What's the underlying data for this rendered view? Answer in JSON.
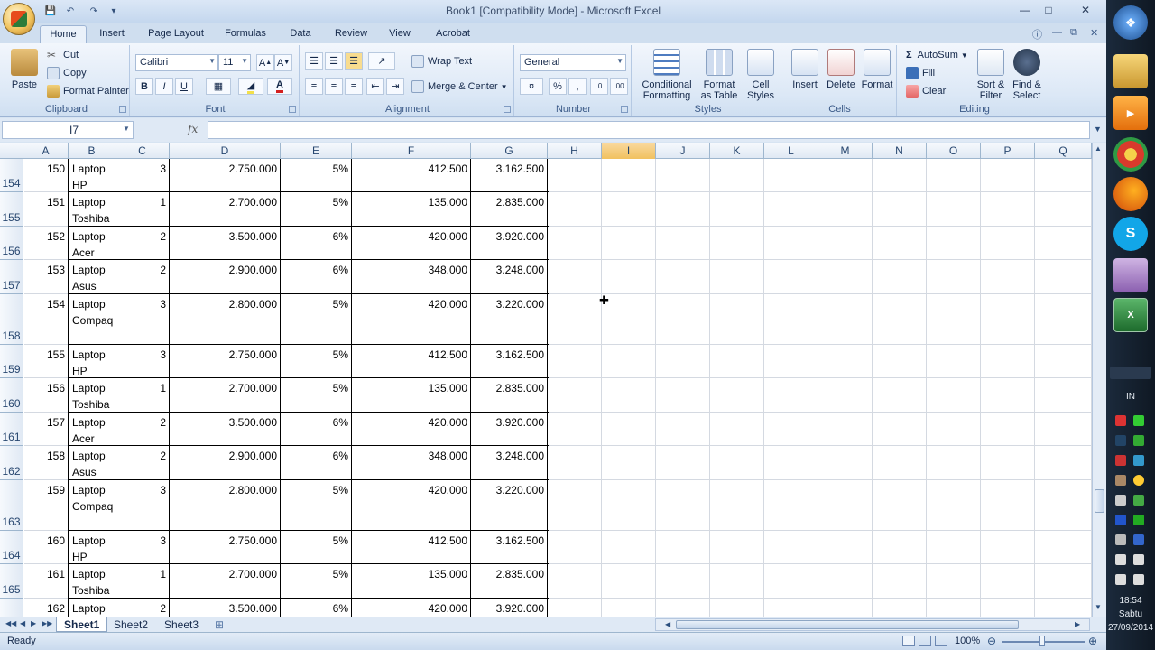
{
  "window": {
    "title": "Book1  [Compatibility Mode] - Microsoft Excel"
  },
  "ribbon_tabs": [
    "Home",
    "Insert",
    "Page Layout",
    "Formulas",
    "Data",
    "Review",
    "View",
    "Acrobat"
  ],
  "clipboard": {
    "paste": "Paste",
    "cut": "Cut",
    "copy": "Copy",
    "format_painter": "Format Painter",
    "label": "Clipboard"
  },
  "font": {
    "name": "Calibri",
    "size": "11",
    "bold": "B",
    "italic": "I",
    "underline": "U",
    "label": "Font"
  },
  "alignment": {
    "wrap_text": "Wrap Text",
    "merge_center": "Merge & Center",
    "label": "Alignment"
  },
  "number": {
    "format": "General",
    "percent": "%",
    "comma": ",",
    "label": "Number"
  },
  "styles": {
    "conditional_formatting": [
      "Conditional",
      "Formatting"
    ],
    "format_as_table": [
      "Format",
      "as Table"
    ],
    "cell_styles": [
      "Cell",
      "Styles"
    ],
    "label": "Styles"
  },
  "cells": {
    "insert": "Insert",
    "delete": "Delete",
    "format": "Format",
    "label": "Cells"
  },
  "editing": {
    "autosum": "AutoSum",
    "fill": "Fill",
    "clear": "Clear",
    "sort_filter": [
      "Sort &",
      "Filter"
    ],
    "find_select": [
      "Find &",
      "Select"
    ],
    "label": "Editing"
  },
  "formula_bar": {
    "name_box": "I7",
    "fx": "fx",
    "value": ""
  },
  "columns": [
    "A",
    "B",
    "C",
    "D",
    "E",
    "F",
    "G",
    "H",
    "I",
    "J",
    "K",
    "L",
    "M",
    "N",
    "O",
    "P",
    "Q"
  ],
  "selected_column": "I",
  "rows": [
    {
      "row": "154",
      "a": "150",
      "b1": "Laptop",
      "b2": "HP",
      "c": "3",
      "d": "2.750.000",
      "e": "5%",
      "f": "412.500",
      "g": "3.162.500"
    },
    {
      "row": "155",
      "a": "151",
      "b1": "Laptop",
      "b2": "Toshiba",
      "c": "1",
      "d": "2.700.000",
      "e": "5%",
      "f": "135.000",
      "g": "2.835.000"
    },
    {
      "row": "156",
      "a": "152",
      "b1": "Laptop",
      "b2": "Acer",
      "c": "2",
      "d": "3.500.000",
      "e": "6%",
      "f": "420.000",
      "g": "3.920.000"
    },
    {
      "row": "157",
      "a": "153",
      "b1": "Laptop",
      "b2": "Asus",
      "c": "2",
      "d": "2.900.000",
      "e": "6%",
      "f": "348.000",
      "g": "3.248.000"
    },
    {
      "row": "158",
      "a": "154",
      "b1": "Laptop",
      "b2": "Compaq",
      "c": "3",
      "d": "2.800.000",
      "e": "5%",
      "f": "420.000",
      "g": "3.220.000"
    },
    {
      "row": "159",
      "a": "155",
      "b1": "Laptop",
      "b2": "HP",
      "c": "3",
      "d": "2.750.000",
      "e": "5%",
      "f": "412.500",
      "g": "3.162.500"
    },
    {
      "row": "160",
      "a": "156",
      "b1": "Laptop",
      "b2": "Toshiba",
      "c": "1",
      "d": "2.700.000",
      "e": "5%",
      "f": "135.000",
      "g": "2.835.000"
    },
    {
      "row": "161",
      "a": "157",
      "b1": "Laptop",
      "b2": "Acer",
      "c": "2",
      "d": "3.500.000",
      "e": "6%",
      "f": "420.000",
      "g": "3.920.000"
    },
    {
      "row": "162",
      "a": "158",
      "b1": "Laptop",
      "b2": "Asus",
      "c": "2",
      "d": "2.900.000",
      "e": "6%",
      "f": "348.000",
      "g": "3.248.000"
    },
    {
      "row": "163",
      "a": "159",
      "b1": "Laptop",
      "b2": "Compaq",
      "c": "3",
      "d": "2.800.000",
      "e": "5%",
      "f": "420.000",
      "g": "3.220.000"
    },
    {
      "row": "164",
      "a": "160",
      "b1": "Laptop",
      "b2": "HP",
      "c": "3",
      "d": "2.750.000",
      "e": "5%",
      "f": "412.500",
      "g": "3.162.500"
    },
    {
      "row": "165",
      "a": "161",
      "b1": "Laptop",
      "b2": "Toshiba",
      "c": "1",
      "d": "2.700.000",
      "e": "5%",
      "f": "135.000",
      "g": "2.835.000"
    },
    {
      "row": "",
      "a": "162",
      "b1": "Laptop",
      "b2": "",
      "c": "2",
      "d": "3.500.000",
      "e": "6%",
      "f": "420.000",
      "g": "3.920.000"
    }
  ],
  "sheets": [
    "Sheet1",
    "Sheet2",
    "Sheet3"
  ],
  "active_sheet": "Sheet1",
  "status": {
    "ready": "Ready",
    "zoom": "100%"
  },
  "taskbar": {
    "lang": "IN",
    "time": "18:54",
    "day": "Sabtu",
    "date": "27/09/2014"
  },
  "colors": {
    "ribbon_bg": "#dce8f6",
    "selected_header": "#f1c15f",
    "taskbar": "#1b2a3c"
  }
}
